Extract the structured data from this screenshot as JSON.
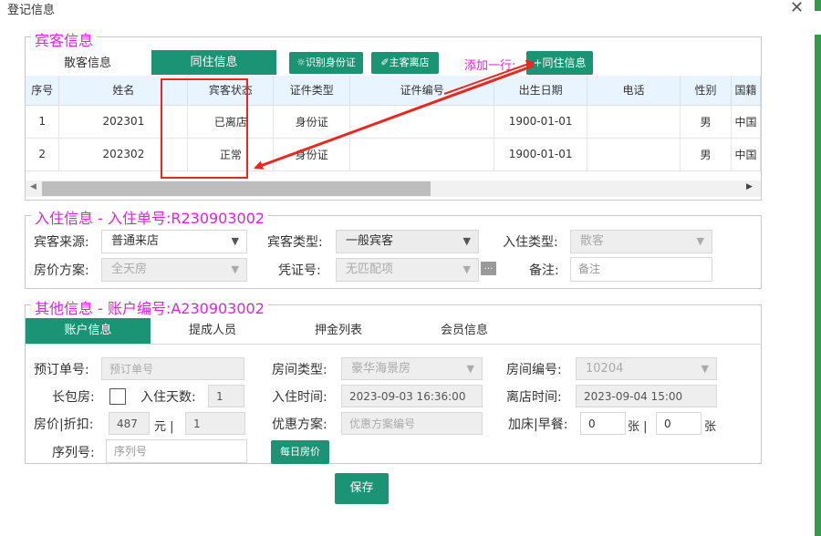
{
  "dialog": {
    "title": "登记信息",
    "close_glyph": "✕"
  },
  "guest_section": {
    "legend": "宾客信息",
    "tabs": {
      "walkin": "散客信息",
      "cohabit": "同住信息"
    },
    "buttons": {
      "id_card": "☼识别身份证",
      "main_guest_checkout": "✐主客离店",
      "add_cohabit": "+同住信息"
    },
    "add_row_label": "添加一行:",
    "columns": [
      "序号",
      "姓名",
      "宾客状态",
      "证件类型",
      "证件编号",
      "出生日期",
      "电话",
      "性别",
      "国籍"
    ],
    "rows": [
      [
        "1",
        "202301",
        "已离店",
        "身份证",
        "",
        "1900-01-01",
        "",
        "男",
        "中国"
      ],
      [
        "2",
        "202302",
        "正常",
        "身份证",
        "",
        "1900-01-01",
        "",
        "男",
        "中国"
      ]
    ],
    "scroll_left": "◀",
    "scroll_right": "▶"
  },
  "checkin_section": {
    "legend": "入住信息 - 入住单号:R230903002",
    "guest_source_label": "宾客来源:",
    "guest_source_value": "普通来店",
    "guest_type_label": "宾客类型:",
    "guest_type_value": "一般宾客",
    "checkin_type_label": "入住类型:",
    "checkin_type_value": "散客",
    "rate_plan_label": "房价方案:",
    "rate_plan_value": "全天房",
    "voucher_label": "凭证号:",
    "voucher_value": "无匹配项",
    "more_glyph": "...",
    "remark_label": "备注:",
    "remark_placeholder": "备注"
  },
  "other_section": {
    "legend": "其他信息 - 账户编号:A230903002",
    "tabs": {
      "account": "账户信息",
      "commission": "提成人员",
      "deposit": "押金列表",
      "member": "会员信息"
    },
    "booking_no_label": "预订单号:",
    "booking_no_placeholder": "预订单号",
    "room_type_label": "房间类型:",
    "room_type_value": "豪华海景房",
    "room_no_label": "房间编号:",
    "room_no_value": "10204",
    "long_stay_label": "长包房:",
    "days_label": "入住天数:",
    "days_value": "1",
    "checkin_time_label": "入住时间:",
    "checkin_time_value": "2023-09-03 16:36:00",
    "checkout_time_label": "离店时间:",
    "checkout_time_value": "2023-09-04 15:00",
    "price_label": "房价|折扣:",
    "price_value": "487",
    "price_unit": "元 |",
    "discount_value": "1",
    "promo_label": "优惠方案:",
    "promo_placeholder": "优惠方案编号",
    "extra_label": "加床|早餐:",
    "extra_bed_value": "0",
    "extra_bed_unit": "张 |",
    "breakfast_value": "0",
    "breakfast_unit": "张",
    "serial_label": "序列号:",
    "serial_placeholder": "序列号",
    "daily_price_button": "每日房价"
  },
  "save_button": "保存",
  "colors": {
    "accent": "#1a9474",
    "legend": "#e31ee3",
    "annotation": "#e8281e",
    "side_bar": "#2f9e46"
  }
}
